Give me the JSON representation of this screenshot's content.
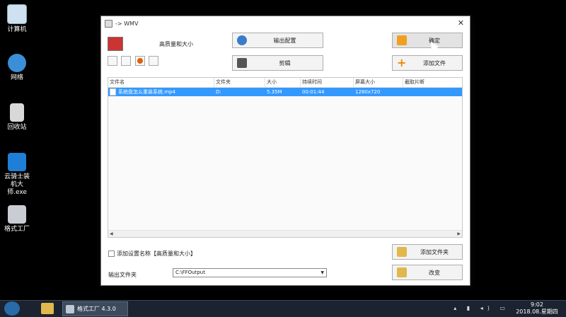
{
  "desktop": {
    "icons": [
      {
        "label": "计算机",
        "icon": "computer-icon",
        "color": "#cfe0f0"
      },
      {
        "label": "网络",
        "icon": "network-icon",
        "color": "#3a8fd8"
      },
      {
        "label": "回收站",
        "icon": "recycle-bin-icon",
        "color": "#d8d8d8"
      },
      {
        "label": "云骑士装机大师.exe",
        "icon": "yunqishi-icon",
        "color": "#1f7fd6"
      },
      {
        "label": "格式工厂",
        "icon": "format-factory-icon",
        "color": "#c9ccd3"
      }
    ]
  },
  "dialog": {
    "title": "-> WMV",
    "preset_label": "高质量和大小",
    "buttons": {
      "output_config": "输出配置",
      "clip": "剪辑",
      "ok": "确定",
      "add_file": "添加文件",
      "add_folder": "添加文件夹",
      "change": "改变"
    },
    "table": {
      "columns": [
        "文件名",
        "文件夹",
        "大小",
        "持续时间",
        "屏幕大小",
        "截取片断"
      ],
      "rows": [
        {
          "filename": "系统盘怎么重装系统.mp4",
          "folder": "D:",
          "size": "5.35M",
          "duration": "00:01:44",
          "screen": "1280x720",
          "clip": ""
        }
      ]
    },
    "checkbox_label": "添加设置名称【高质量和大小】",
    "output_folder_label": "输出文件夹",
    "output_folder_value": "C:\\FFOutput"
  },
  "taskbar": {
    "app_label": "格式工厂 4.3.0",
    "time": "9:02",
    "date": "2018.08.星期四"
  }
}
